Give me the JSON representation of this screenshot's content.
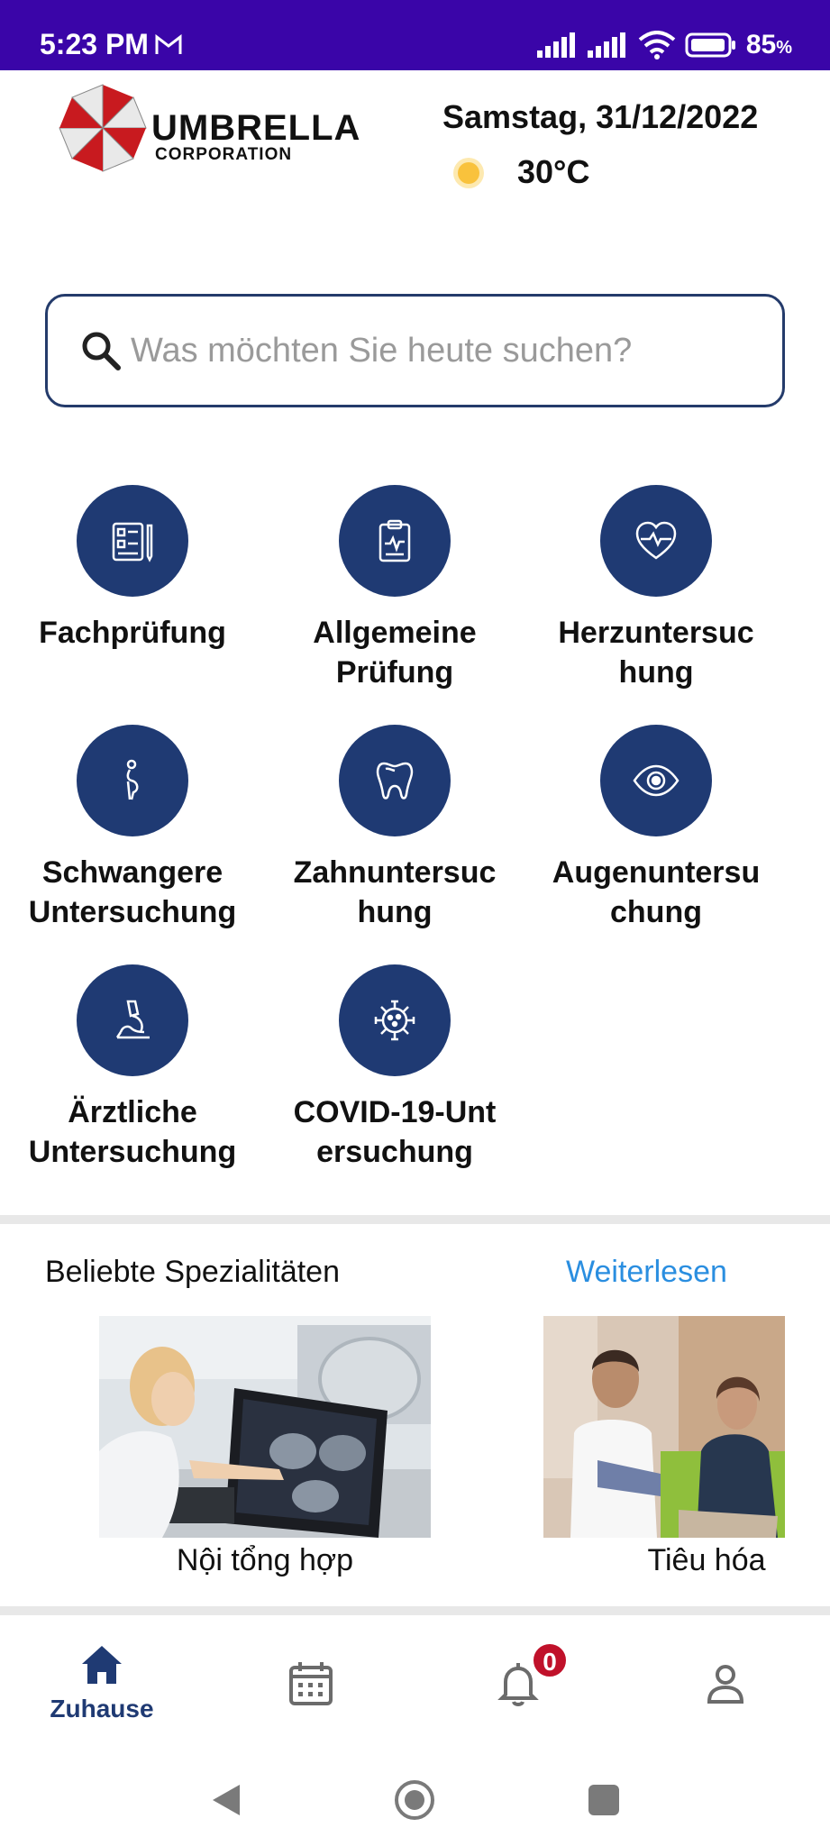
{
  "status_bar": {
    "time": "5:23 PM",
    "battery_percent": "85",
    "battery_unit": "%"
  },
  "header": {
    "logo_main": "UMBRELLA",
    "logo_sub": "CORPORATION",
    "date": "Samstag, 31/12/2022",
    "temperature": "30°C"
  },
  "search": {
    "placeholder": "Was möchten Sie heute suchen?"
  },
  "categories": [
    {
      "label": "Fachprüfung",
      "icon": "checklist-icon"
    },
    {
      "label": "Allgemeine Prüfung",
      "icon": "clipboard-icon"
    },
    {
      "label": "Herzuntersuchung",
      "icon": "heart-pulse-icon"
    },
    {
      "label": "Schwangere Untersuchung",
      "icon": "pregnant-icon"
    },
    {
      "label": "Zahnuntersuchung",
      "icon": "tooth-icon"
    },
    {
      "label": "Augenuntersuchung",
      "icon": "eye-icon"
    },
    {
      "label": "Ärztliche Untersuchung",
      "icon": "microscope-icon"
    },
    {
      "label": "COVID-19-Untersuchung",
      "icon": "virus-icon"
    }
  ],
  "category_display": [
    [
      "Fachprüfung"
    ],
    [
      "Allgemeine",
      "Prüfung"
    ],
    [
      "Herzuntersuc",
      "hung"
    ],
    [
      "Schwangere",
      "Untersuchung"
    ],
    [
      "Zahnuntersuc",
      "hung"
    ],
    [
      "Augenuntersu",
      "chung"
    ],
    [
      "Ärztliche",
      "Untersuchung"
    ],
    [
      "COVID-19-Unt",
      "ersuchung"
    ]
  ],
  "popular": {
    "title": "Beliebte Spezialitäten",
    "more_label": "Weiterlesen",
    "items": [
      {
        "label": "Nội tổng hợp"
      },
      {
        "label": "Tiêu hóa"
      }
    ]
  },
  "bottom_nav": {
    "home_label": "Zuhause",
    "notification_count": "0"
  },
  "colors": {
    "status_bar": "#3a05a8",
    "primary": "#1f3a73",
    "link": "#2a8ee0",
    "badge": "#c0112a"
  }
}
